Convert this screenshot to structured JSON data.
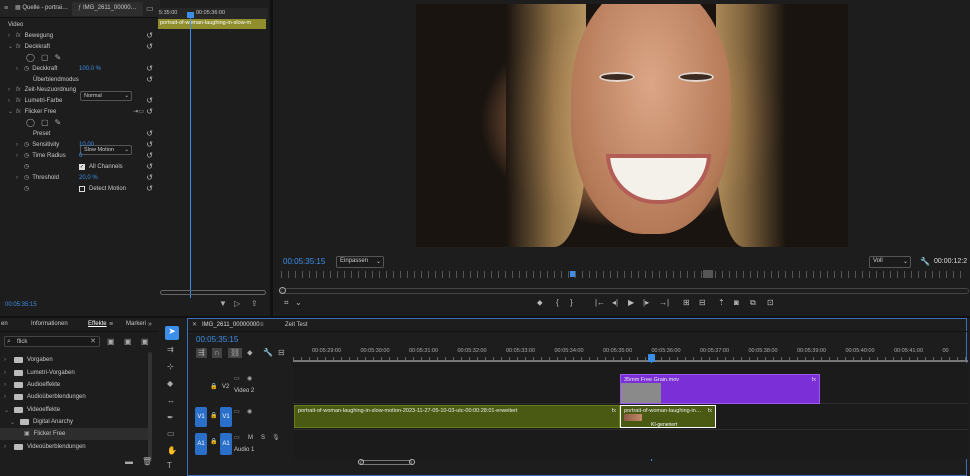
{
  "source_panel": {
    "tabs": [
      "Quelle - portrai…",
      "IMG_2611_00000…"
    ],
    "mini_timecode": "5:35:00",
    "mini_tc2": "00:05:36:00",
    "clip_label": "portrait-of-woman-laughing-in-slow-m",
    "section_label": "Video",
    "bottom_timecode": "00:05:35:15",
    "effects": {
      "bewegung": "Bewegung",
      "deckkraft_group": "Deckkraft",
      "deckkraft": "Deckkraft",
      "deckkraft_value": "100,0 %",
      "blendmode_label": "Überblendmodus",
      "blendmode_value": "Normal",
      "zeit": "Zeit-Neuzuordnung",
      "lumetri": "Lumetri-Farbe",
      "flicker": "Flicker Free",
      "preset_label": "Preset",
      "preset_value": "Slow Motion",
      "sensitivity_label": "Sensitivity",
      "sensitivity_value": "10,00",
      "time_radius_label": "Time Radius",
      "time_radius_value": "6",
      "all_channels": "All Channels",
      "threshold_label": "Threshold",
      "threshold_value": "20,0 %",
      "detect_motion": "Detect Motion"
    }
  },
  "program": {
    "timecode": "00:05:35:15",
    "fit": "Einpassen",
    "quality": "Voll",
    "end_timecode": "00:00:12:2"
  },
  "effects_panel": {
    "tabs": [
      "en",
      "Informationen",
      "Effekte",
      "Markeri"
    ],
    "search_value": "flick",
    "tree": [
      {
        "label": "Vorgaben"
      },
      {
        "label": "Lumetri-Vorgaben"
      },
      {
        "label": "Audioeffekte"
      },
      {
        "label": "Audioüberblendungen"
      },
      {
        "label": "Videoeffekte"
      },
      {
        "label": "Digital Anarchy"
      },
      {
        "label": "Flicker Free"
      },
      {
        "label": "Videoüberblendungen"
      }
    ]
  },
  "timeline": {
    "tabs": [
      "IMG_2611_00000000",
      "Zeit Test"
    ],
    "timecode": "00:05:35:15",
    "ruler": [
      "00:05:29:00",
      "00:05:30:00",
      "00:05:31:00",
      "00:05:32:00",
      "00:05:33:00",
      "00:05:34:00",
      "00:05:35:00",
      "00:05:36:00",
      "00:05:37:00",
      "00:05:38:00",
      "00:05:39:00",
      "00:05:40:00",
      "00:05:41:00",
      "00"
    ],
    "tracks": {
      "v2": "V2",
      "v2_name": "Video 2",
      "v1": "V1",
      "v1_src": "V1",
      "a1": "A1",
      "a1_src": "A1",
      "a1_name": "Audio 1"
    },
    "clips": {
      "v1_main": "portrait-of-woman-laughing-in-slow-motion-2023-11-27-05-10-03-utc-00:00:28:01-erweitert",
      "v1_selected": "portrait-of-woman-laughing-in…",
      "ki_badge": "KI-generiert",
      "v2": "35mm Free Grain.mov"
    }
  }
}
